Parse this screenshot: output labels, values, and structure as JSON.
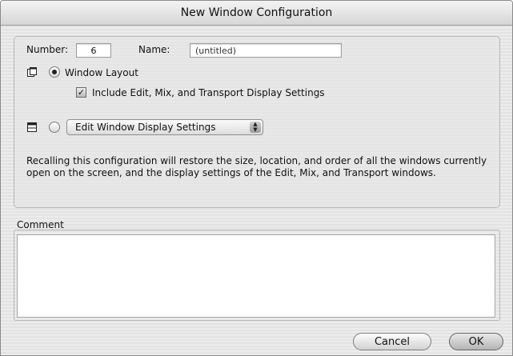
{
  "window": {
    "title": "New Window Configuration"
  },
  "form": {
    "number_label": "Number:",
    "number_value": "6",
    "name_label": "Name:",
    "name_value": "(untitled)",
    "window_layout_label": "Window Layout",
    "window_layout_selected": true,
    "include_settings_label": "Include Edit, Mix, and Transport Display Settings",
    "include_settings_checked": true,
    "display_settings_selected": false,
    "display_settings_option": "Edit Window Display Settings"
  },
  "description": "Recalling this configuration will restore the size, location, and order of all the windows currently open on the screen, and the display settings of the Edit, Mix, and Transport windows.",
  "comment": {
    "label": "Comment",
    "value": ""
  },
  "buttons": {
    "cancel": "Cancel",
    "ok": "OK"
  },
  "icons": {
    "layout": "window-layout-icon",
    "display": "display-settings-icon",
    "checkmark": "checkmark-icon",
    "popup_arrows": "updown-arrows-icon"
  }
}
